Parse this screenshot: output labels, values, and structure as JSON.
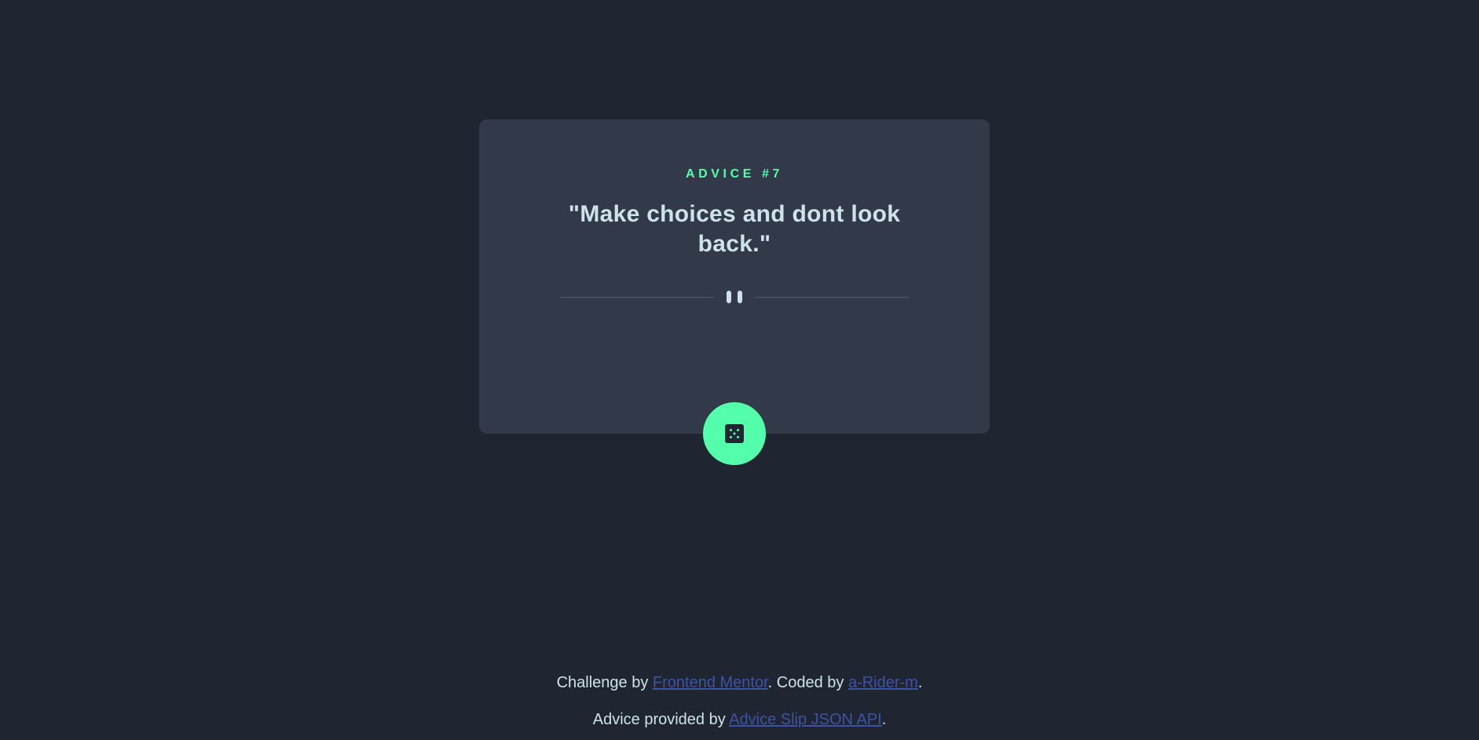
{
  "card": {
    "advice_label": "ADVICE #7",
    "quote": "\"Make choices and dont look back.\""
  },
  "divider": {
    "icon": "pause-icon"
  },
  "dice_button": {
    "icon": "dice-icon",
    "color": "#53ffaa"
  },
  "footer": {
    "line1": {
      "prefix": "Challenge by ",
      "link1": "Frontend Mentor",
      "middle": ". Coded by ",
      "link2": "a-Rider-m",
      "suffix": "."
    },
    "line2": {
      "prefix": "Advice provided by ",
      "link": "Advice Slip JSON API",
      "suffix": "."
    }
  },
  "colors": {
    "background": "#1f2632",
    "card": "#323a49",
    "accent": "#53ffaa",
    "text": "#cee3e9",
    "link": "#3e52a3",
    "divider": "#4f5d74"
  }
}
